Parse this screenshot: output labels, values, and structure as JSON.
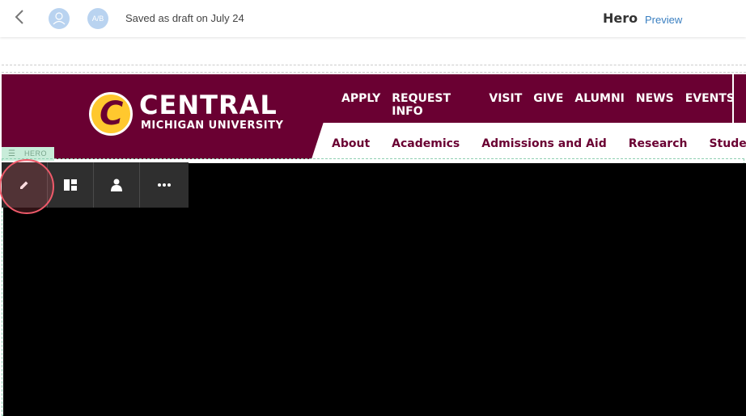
{
  "topbar": {
    "back_icon": "chevron-left-icon",
    "user_avatar_icon": "user-icon",
    "ab_label": "A/B",
    "saved_text": "Saved as draft on July 24",
    "page_title": "Hero",
    "preview_label": "Preview"
  },
  "header": {
    "logo_word": "CENTRAL",
    "logo_sub": "MICHIGAN UNIVERSITY",
    "seal_letter": "C",
    "utility_nav": [
      "APPLY",
      "REQUEST INFO",
      "VISIT",
      "GIVE",
      "ALUMNI",
      "NEWS",
      "EVENTS"
    ],
    "main_nav": [
      "About",
      "Academics",
      "Admissions and Aid",
      "Research",
      "Student Life"
    ],
    "brand_color": "#6a0032",
    "accent_color": "#ffc82e"
  },
  "hero": {
    "tag_label": "HERO",
    "toolbar": [
      "pencil-icon",
      "layout-icon",
      "user-icon",
      "more-icon"
    ]
  }
}
